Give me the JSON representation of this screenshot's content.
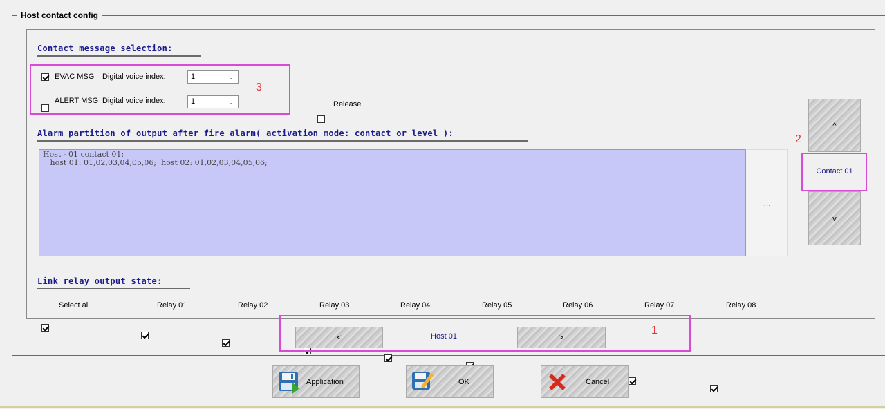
{
  "section_title": "Host contact config",
  "contact_message": {
    "title": "Contact message selection:",
    "evac": {
      "label": "EVAC MSG",
      "checked": true,
      "voice_label": "Digital voice index:",
      "voice_value": "1"
    },
    "alert": {
      "label": "ALERT MSG",
      "checked": false,
      "voice_label": "Digital voice index:",
      "voice_value": "1"
    },
    "release": {
      "label": "Release",
      "checked": false
    }
  },
  "alarm_partition": {
    "title": "Alarm partition of output after fire alarm( activation mode: contact or level ):",
    "text": "Host - 01 contact 01:\n   host 01: 01,02,03,04,05,06;  host 02: 01,02,03,04,05,06;",
    "dots_label": "..."
  },
  "contact_nav": {
    "up": "^",
    "label": "Contact 01",
    "down": "v"
  },
  "relay": {
    "title": "Link relay output state:",
    "select_all": {
      "label": "Select all",
      "checked": true
    },
    "items": [
      {
        "label": "Relay 01",
        "checked": true
      },
      {
        "label": "Relay 02",
        "checked": true
      },
      {
        "label": "Relay 03",
        "checked": true
      },
      {
        "label": "Relay 04",
        "checked": true
      },
      {
        "label": "Relay 05",
        "checked": true
      },
      {
        "label": "Relay 06",
        "checked": true
      },
      {
        "label": "Relay 07",
        "checked": true
      },
      {
        "label": "Relay 08",
        "checked": true
      }
    ]
  },
  "host_nav": {
    "prev": "<",
    "label": "Host 01",
    "next": ">"
  },
  "annotations": {
    "one": "1",
    "two": "2",
    "three": "3"
  },
  "footer": {
    "application": "Application",
    "ok": "OK",
    "cancel": "Cancel"
  },
  "colors": {
    "annotation": "#d94bd6",
    "annotation_number": "#e53131",
    "title_blue": "#1a1a8c",
    "panel_bg": "#c8c8f8"
  }
}
